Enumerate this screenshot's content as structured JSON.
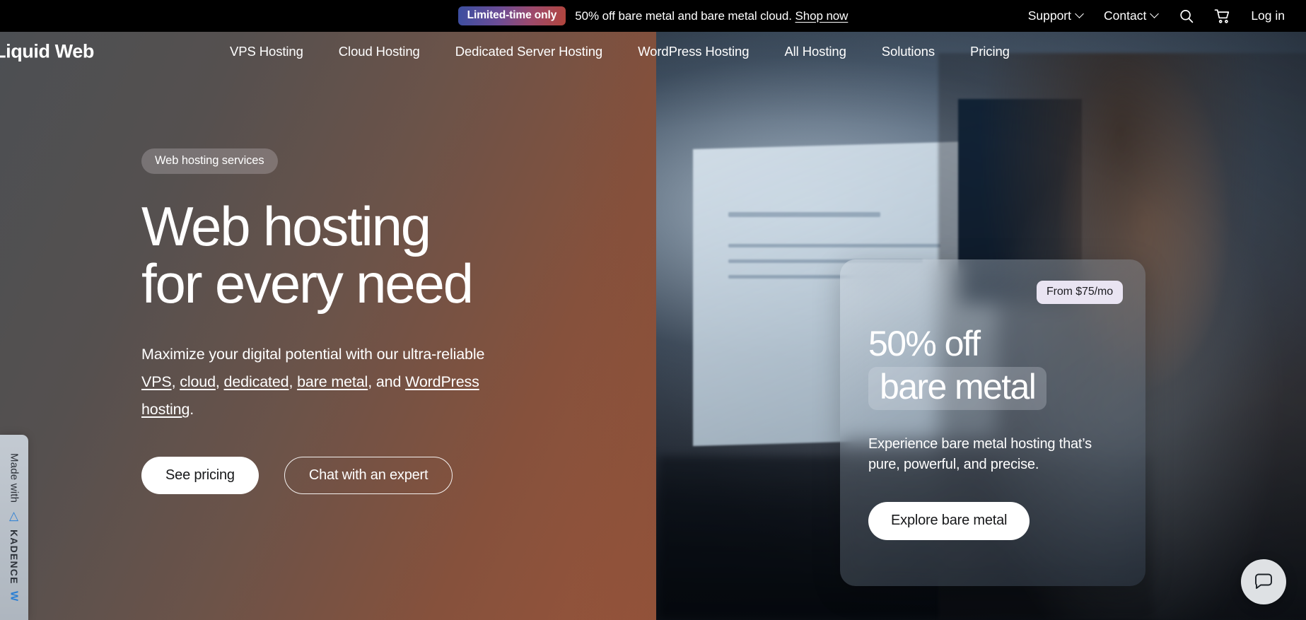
{
  "promo_bar": {
    "badge": "Limited-time only",
    "message": "50% off bare metal and bare metal cloud.",
    "link": "Shop now",
    "right_items": [
      {
        "label": "Support",
        "icon": "chevron-down-icon"
      },
      {
        "label": "Contact",
        "icon": "chevron-down-icon"
      }
    ],
    "search_icon": "search-icon",
    "cart_icon": "shopping-cart-icon",
    "login": "Log in",
    "background": "#000000",
    "badge_gradient_from": "#3b4ea0",
    "badge_gradient_to": "#b2453c"
  },
  "nav": {
    "logo": "Liquid Web",
    "links": [
      "VPS Hosting",
      "Cloud Hosting",
      "Dedicated Server Hosting",
      "WordPress Hosting",
      "All Hosting",
      "Solutions",
      "Pricing"
    ]
  },
  "hero": {
    "eyebrow": "Web hosting services",
    "heading_line1": "Web hosting",
    "heading_line2": "for every need",
    "lede_before": "Maximize your digital potential with our ultra-reliable ",
    "link_vps": "VPS",
    "sep1": ", ",
    "link_cloud": "cloud",
    "sep2": ", ",
    "link_dedicated": "dedicated",
    "sep3": ", ",
    "link_bare_metal": "bare metal",
    "sep4": ", and ",
    "link_wordpress": "WordPress hosting",
    "lede_end": ".",
    "primary_cta": "See pricing",
    "secondary_cta": "Chat with an expert"
  },
  "promo_card": {
    "price_badge": "From $75/mo",
    "heading_line1": "50% off",
    "heading_highlight": "bare metal",
    "body": "Experience bare metal hosting that’s pure, powerful, and precise.",
    "cta": "Explore bare metal",
    "badge_bg": "#e9e4f2"
  },
  "kadence_badge": {
    "prefix": "Made with",
    "mark_icon": "kadence-logo-icon",
    "name": "KADENCE",
    "suffix": "W",
    "accent": "#2a7fd4"
  },
  "chat_widget": {
    "icon": "chat-bubble-icon"
  }
}
